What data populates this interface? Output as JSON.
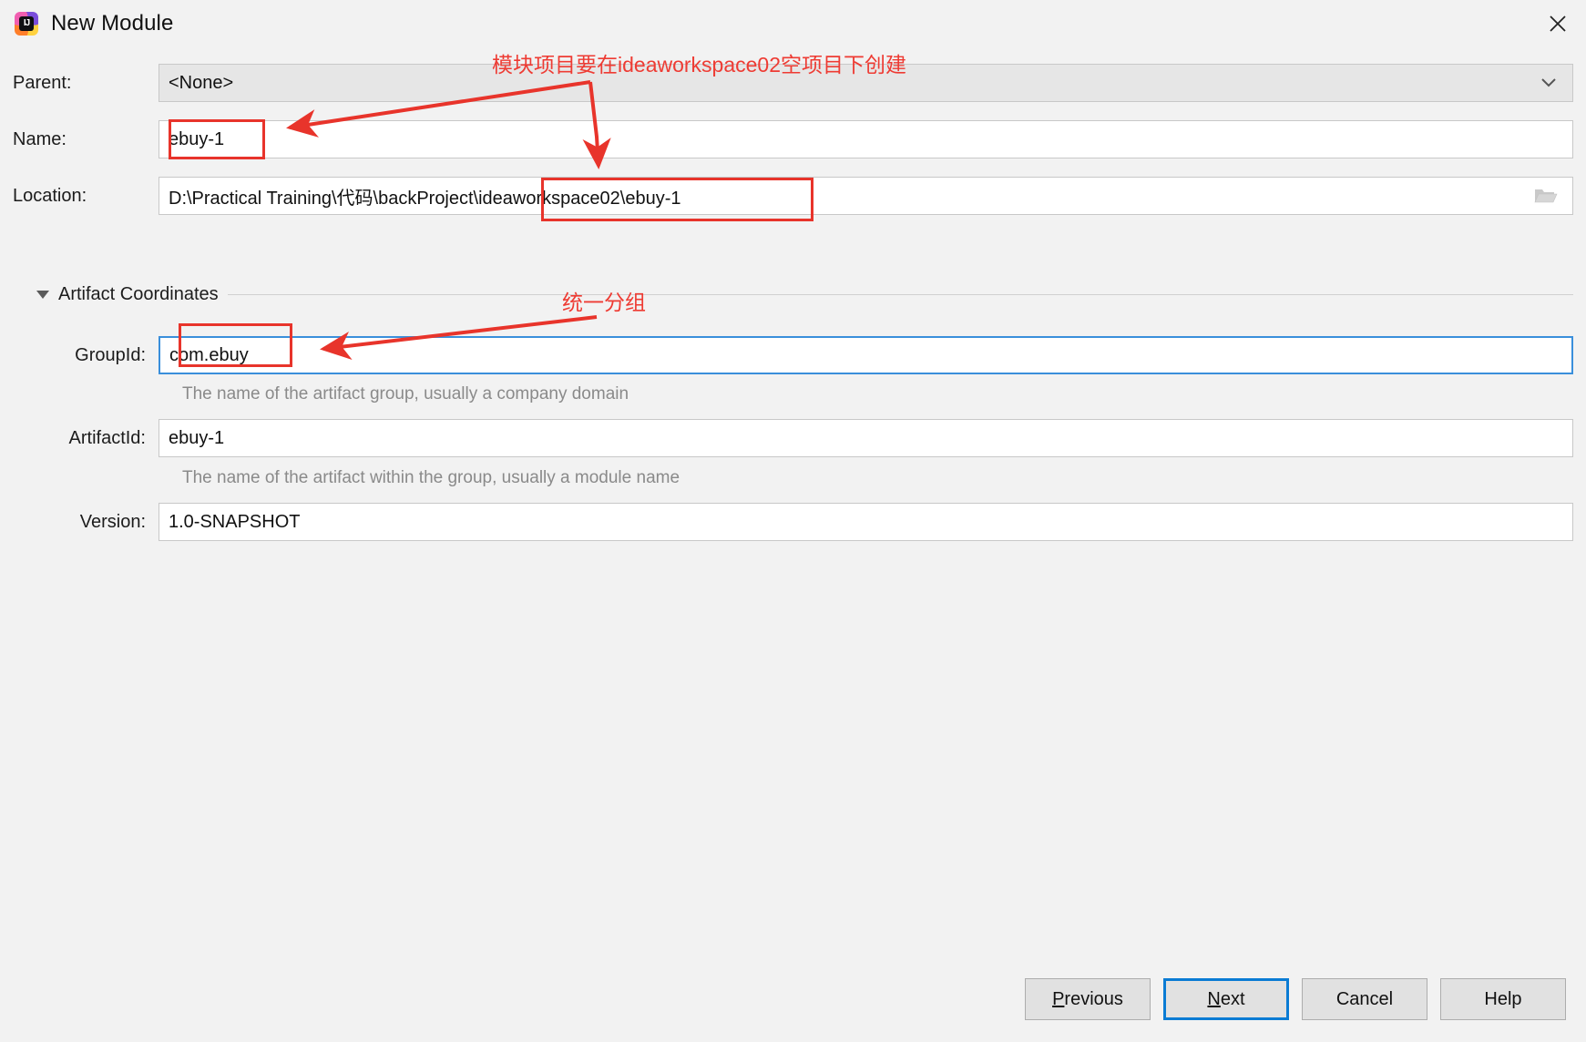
{
  "window": {
    "title": "New Module",
    "app_icon": "intellij-idea-icon",
    "close_icon": "close-icon"
  },
  "form": {
    "parent": {
      "label": "Parent:",
      "value": "<None>",
      "dropdown_icon": "chevron-down-icon"
    },
    "name": {
      "label": "Name:",
      "value": "ebuy-1"
    },
    "location": {
      "label": "Location:",
      "value": "D:\\Practical Training\\代码\\backProject\\ideaworkspace02\\ebuy-1",
      "browse_icon": "folder-icon"
    }
  },
  "artifact_section": {
    "title": "Artifact Coordinates",
    "collapse_icon": "triangle-down-icon",
    "group_id": {
      "label": "GroupId:",
      "value": "com.ebuy",
      "hint": "The name of the artifact group, usually a company domain"
    },
    "artifact_id": {
      "label": "ArtifactId:",
      "value": "ebuy-1",
      "hint": "The name of the artifact within the group, usually a module name"
    },
    "version": {
      "label": "Version:",
      "value": "1.0-SNAPSHOT"
    }
  },
  "annotations": {
    "top_note": "模块项目要在ideaworkspace02空项目下创建",
    "group_note": "统一分组",
    "color": "#ee3b33"
  },
  "buttons": {
    "previous": {
      "prefix": "",
      "accel": "P",
      "suffix": "revious"
    },
    "next": {
      "prefix": "",
      "accel": "N",
      "suffix": "ext"
    },
    "cancel": {
      "label": "Cancel"
    },
    "help": {
      "label": "Help"
    }
  },
  "colors": {
    "focus_blue": "#3a8fdb",
    "default_button_blue": "#0a7bd4",
    "annotation_red": "#e8342b"
  }
}
